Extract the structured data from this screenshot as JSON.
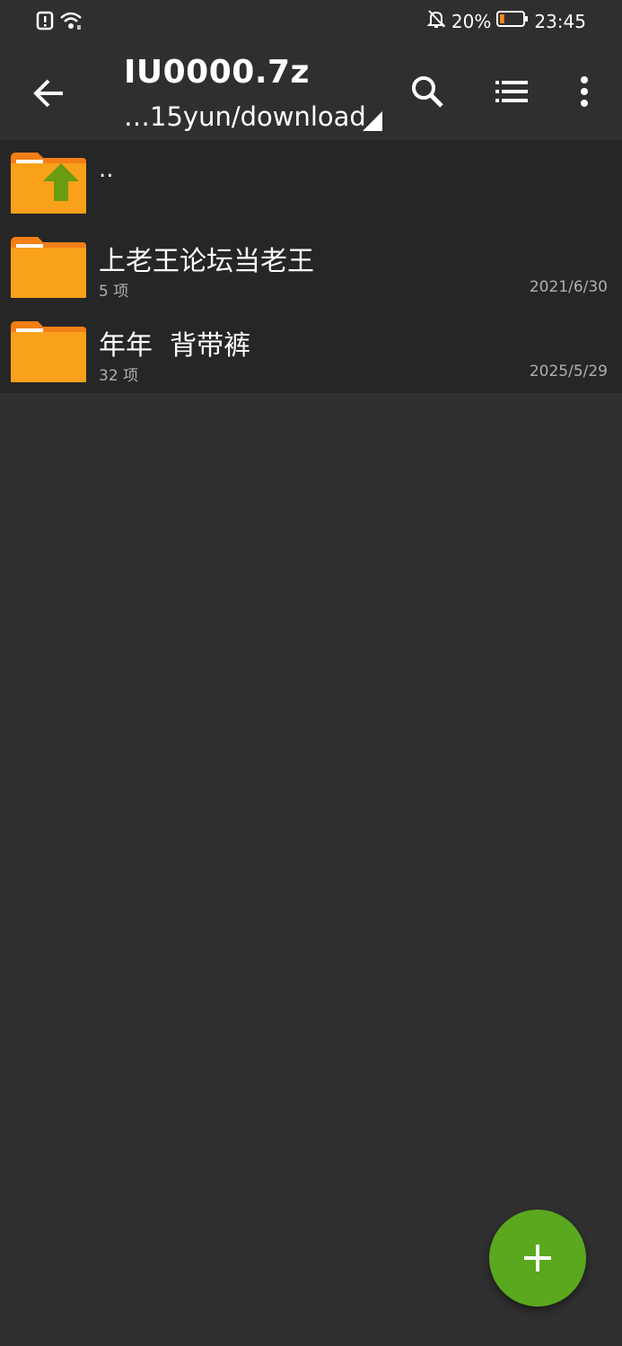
{
  "status_bar": {
    "battery_percent": "20%",
    "time": "23:45",
    "battery_level": 0.2,
    "icons": [
      "alert-icon",
      "wifi-icon",
      "bell-off-icon",
      "battery-icon"
    ]
  },
  "toolbar": {
    "title": "IU0000.7z",
    "path": "…15yun/download",
    "icons": [
      "back-arrow-icon",
      "search-icon",
      "list-view-icon",
      "more-vert-icon"
    ]
  },
  "files": {
    "up": {
      "label": ".."
    },
    "items": [
      {
        "name": "上老王论坛当老王",
        "count": "5 项",
        "date": "2021/6/30"
      },
      {
        "name": "年年  背带裤",
        "count": "32 项",
        "date": "2025/5/29"
      }
    ]
  },
  "fab": {
    "icon": "plus-icon"
  },
  "colors": {
    "background": "#303030",
    "toolbar": "#2f2f2f",
    "list_background": "#262626",
    "folder_orange": "#f9a11b",
    "folder_tab": "#f37f16",
    "up_arrow_green": "#6a9b10",
    "fab_green": "#5aa81e"
  }
}
